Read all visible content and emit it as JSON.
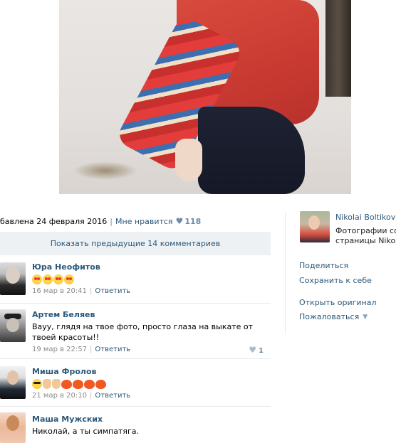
{
  "photo": {
    "alt": ""
  },
  "meta": {
    "date_label": "бавлена 24 февраля 2016",
    "like_label": "Мне нравится",
    "like_count": "118"
  },
  "comments": {
    "show_previous": "Показать предыдущие 14 комментариев",
    "items": [
      {
        "name": "Юра Неофитов",
        "text": "",
        "emojis": [
          "heart-eyes-emoji",
          "heart-eyes-emoji",
          "heart-eyes-emoji",
          "heart-eyes-emoji"
        ],
        "date": "16 мар в 20:41",
        "reply": "Ответить",
        "likes": ""
      },
      {
        "name": "Артем Беляев",
        "text": "Вауу, глядя на твое фото, просто глаза на выкате от твоей красоты!!",
        "emojis": [],
        "date": "19 мар в 22:57",
        "reply": "Ответить",
        "likes": "1"
      },
      {
        "name": "Миша Фролов",
        "text": "",
        "emojis": [
          "sunglasses-emoji",
          "pointing-hand-emoji",
          "thumbs-up-emoji",
          "red-heart-emoji",
          "red-heart-emoji",
          "red-heart-emoji",
          "red-heart-emoji"
        ],
        "date": "21 мар в 20:10",
        "reply": "Ответить",
        "likes": ""
      },
      {
        "name": "Маша Мужских",
        "text": "Николай, а ты симпатяга.",
        "emojis": [],
        "date": "",
        "reply": "",
        "likes": ""
      }
    ]
  },
  "sidebar": {
    "author_name": "Nikolai Boltikov",
    "author_sub_line1": "Фотографии со",
    "author_sub_line2": "страницы Nikolai",
    "share": "Поделиться",
    "save": "Сохранить к себе",
    "open_original": "Открыть оригинал",
    "report": "Пожаловаться"
  },
  "colors": {
    "link": "#2b587a",
    "muted": "#8a8a8a",
    "panel": "#eef1f4",
    "accent_heart": "#6c8ba8"
  }
}
